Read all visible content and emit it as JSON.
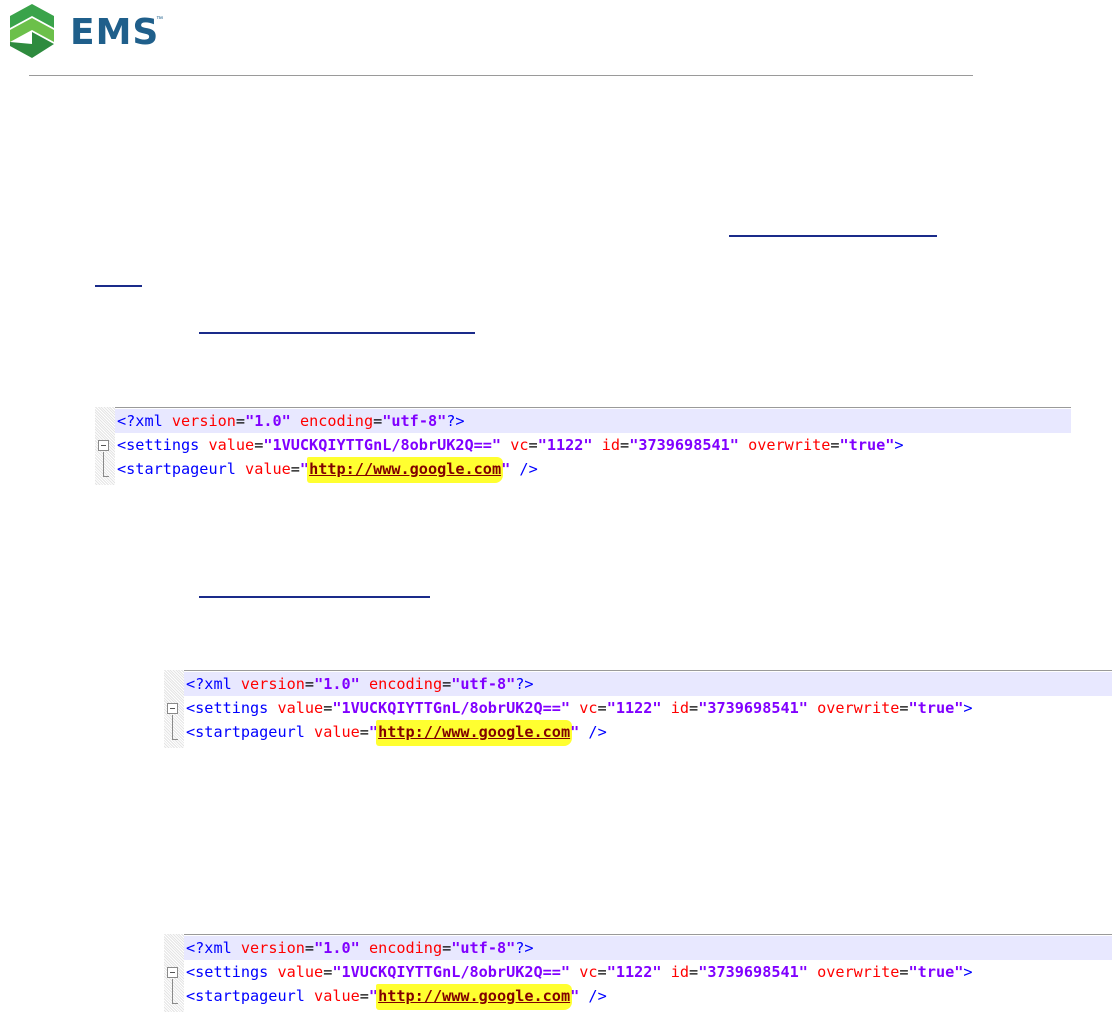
{
  "logo": {
    "text": "EMS",
    "tm": "™"
  },
  "code": {
    "line1": {
      "open": "<?",
      "tag": "xml",
      "attr1": "version",
      "val1": "\"1.0\"",
      "attr2": "encoding",
      "val2": "\"utf-8\"",
      "close": "?>"
    },
    "line2": {
      "lt": "<",
      "tag": "settings",
      "attr1": "value",
      "val1": "\"1VUCKQIYTTGnL/8obrUK2Q==\"",
      "attr2": "vc",
      "val2": "\"1122\"",
      "attr3": "id",
      "val3": "\"3739698541\"",
      "attr4": "overwrite",
      "val4": "\"true\"",
      "gt": ">"
    },
    "line3": {
      "lt": "<",
      "tag": "startpageurl",
      "attr": "value",
      "q1": "\"",
      "url": "http://www.google.com",
      "q2": "\"",
      "close": "/>"
    }
  },
  "colors": {
    "xml_tag": "#0000ff",
    "xml_attr": "#ff0000",
    "xml_value": "#8000ff",
    "url_highlight": "#ffff30",
    "logo_green": "#3aa34a",
    "logo_blue": "#1f5f8b"
  }
}
